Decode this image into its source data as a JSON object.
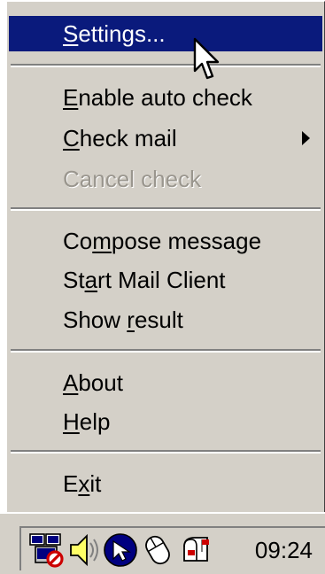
{
  "menu": {
    "items": [
      {
        "pre": "",
        "u": "S",
        "post": "ettings...",
        "state": "highlighted"
      },
      {
        "pre": "",
        "u": "E",
        "post": "nable auto check",
        "state": "normal"
      },
      {
        "pre": "",
        "u": "C",
        "post": "heck mail",
        "state": "normal",
        "submenu": true
      },
      {
        "pre": "Cancel check",
        "u": "",
        "post": "",
        "state": "disabled"
      },
      {
        "pre": "Co",
        "u": "m",
        "post": "pose message",
        "state": "normal"
      },
      {
        "pre": "St",
        "u": "a",
        "post": "rt Mail Client",
        "state": "normal"
      },
      {
        "pre": "Show ",
        "u": "r",
        "post": "esult",
        "state": "normal"
      },
      {
        "pre": "",
        "u": "A",
        "post": "bout",
        "state": "normal"
      },
      {
        "pre": "",
        "u": "H",
        "post": "elp",
        "state": "normal"
      },
      {
        "pre": "E",
        "u": "x",
        "post": "it",
        "state": "normal"
      }
    ],
    "colors": {
      "highlight": "#0a1a7c",
      "background": "#d4d0c8",
      "disabled": "#9a968e"
    }
  },
  "taskbar": {
    "icons": [
      "network-activity-icon",
      "speaker-icon",
      "arrow-cursor-icon",
      "mouse-icon",
      "mail-checker-icon"
    ],
    "clock": "09:24"
  }
}
